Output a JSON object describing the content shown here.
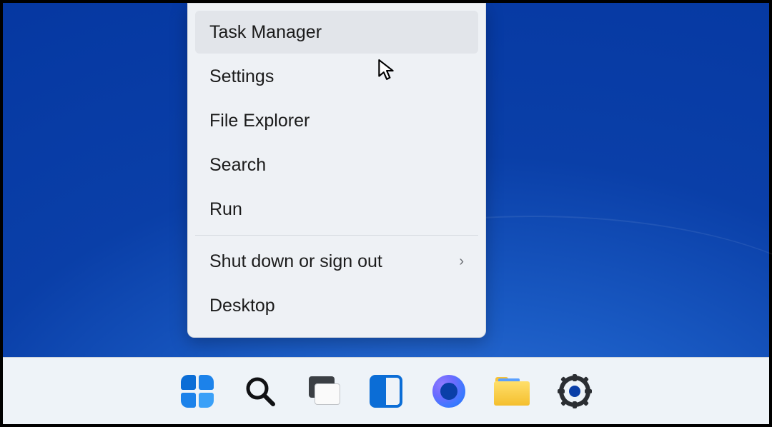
{
  "context_menu": {
    "items": [
      {
        "label": "Task Manager",
        "submenu": false,
        "hovered": true
      },
      {
        "label": "Settings",
        "submenu": false,
        "hovered": false
      },
      {
        "label": "File Explorer",
        "submenu": false,
        "hovered": false
      },
      {
        "label": "Search",
        "submenu": false,
        "hovered": false
      },
      {
        "label": "Run",
        "submenu": false,
        "hovered": false
      }
    ],
    "items2": [
      {
        "label": "Shut down or sign out",
        "submenu": true,
        "hovered": false
      },
      {
        "label": "Desktop",
        "submenu": false,
        "hovered": false
      }
    ],
    "submenu_glyph": "›"
  },
  "taskbar": {
    "items": [
      {
        "name": "start-button",
        "icon": "start-icon"
      },
      {
        "name": "search-button",
        "icon": "search-icon"
      },
      {
        "name": "task-view-button",
        "icon": "task-view-icon"
      },
      {
        "name": "widgets-button",
        "icon": "widgets-icon"
      },
      {
        "name": "chat-button",
        "icon": "chat-icon"
      },
      {
        "name": "file-explorer-button",
        "icon": "folder-icon"
      },
      {
        "name": "settings-button",
        "icon": "gear-icon"
      }
    ]
  },
  "colors": {
    "accent": "#0b6dd6",
    "menu_bg": "#eef1f5",
    "menu_hover": "#e2e5ea",
    "taskbar_bg": "#eef3f8"
  }
}
